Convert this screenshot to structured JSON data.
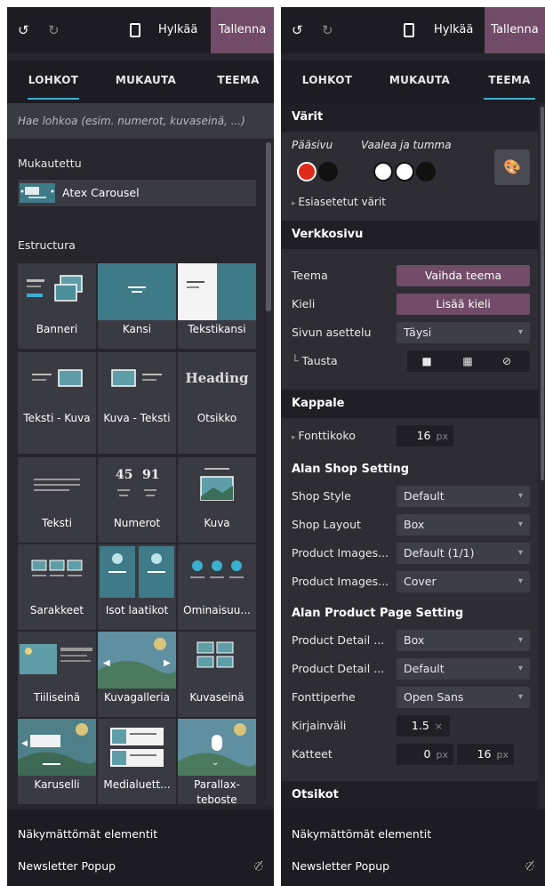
{
  "toolbar": {
    "undo_icon": "undo-icon",
    "redo_icon": "redo-icon",
    "mobile_icon": "mobile-icon",
    "discard_label": "Hylkää",
    "save_label": "Tallenna"
  },
  "tabs": [
    "LOHKOT",
    "MUKAUTA",
    "TEEMA"
  ],
  "left": {
    "search_placeholder": "Hae lohkoa (esim. numerot, kuvaseinä, ...)",
    "custom_section": "Mukautettu",
    "custom_item": "Atex Carousel",
    "structure_section": "Estructura",
    "blocks": [
      [
        "Banneri",
        "Kansi",
        "Tekstikansi"
      ],
      [
        "Teksti - Kuva",
        "Kuva - Teksti",
        "Otsikko"
      ],
      [
        "Teksti",
        "Numerot",
        "Kuva"
      ],
      [
        "Sarakkeet",
        "Isot laatikot",
        "Ominaisuu..."
      ],
      [
        "Tiiliseinä",
        "Kuvagalleria",
        "Kuvaseinä"
      ],
      [
        "Karuselli",
        "Medialuett...",
        "Parallax-teboste"
      ]
    ],
    "heading_word": "Heading",
    "numbers_a": "45",
    "numbers_b": "91"
  },
  "footer": {
    "invisible_label": "Näkymättömät elementit",
    "popup_label": "Newsletter Popup",
    "eye_icon": "eye-slash-icon"
  },
  "right": {
    "colors": {
      "header": "Värit",
      "primary_label": "Pääsivu",
      "light_dark_label": "Vaalea ja tumma",
      "preset_label": "Esiasetetut värit",
      "palette_icon": "palette-icon",
      "swatches": [
        "#e02b1a",
        "#111111",
        "#ffffff",
        "#ffffff",
        "#111111"
      ]
    },
    "website": {
      "header": "Verkkosivu",
      "theme_label": "Teema",
      "theme_button": "Vaihda teema",
      "language_label": "Kieli",
      "language_button": "Lisää kieli",
      "layout_label": "Sivun asettelu",
      "layout_value": "Täysi",
      "background_label": "Tausta",
      "bg_icons": [
        "camera-icon",
        "grid-icon",
        "none-icon"
      ]
    },
    "paragraph": {
      "header": "Kappale",
      "font_size_label": "Fonttikoko",
      "font_size_value": "16",
      "font_size_unit": "px"
    },
    "shop": {
      "subheader": "Alan Shop Setting",
      "rows": [
        {
          "label": "Shop Style",
          "value": "Default"
        },
        {
          "label": "Shop Layout",
          "value": "Box"
        },
        {
          "label": "Product Images...",
          "value": "Default (1/1)"
        },
        {
          "label": "Product Images...",
          "value": "Cover"
        }
      ]
    },
    "product_page": {
      "subheader": "Alan Product Page Setting",
      "rows": [
        {
          "label": "Product Detail ...",
          "value": "Box"
        },
        {
          "label": "Product Detail ...",
          "value": "Default"
        },
        {
          "label": "Fonttiperhe",
          "value": "Open Sans"
        }
      ],
      "letter_spacing_label": "Kirjainväli",
      "letter_spacing_value": "1.5",
      "letter_spacing_unit": "×",
      "margins_label": "Katteet",
      "margin_a": "0",
      "margin_b": "16",
      "margin_unit": "px"
    },
    "headings": {
      "header": "Otsikot"
    }
  }
}
